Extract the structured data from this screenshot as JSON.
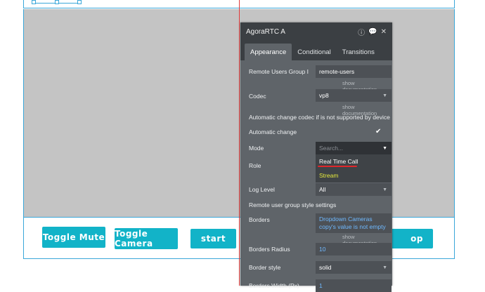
{
  "buttons": {
    "toggle_mute": "Toggle Mute",
    "toggle_camera": "Toggle Camera",
    "start": "start",
    "stop_partial": "op"
  },
  "panel": {
    "title": "AgoraRTC A",
    "tabs": [
      "Appearance",
      "Conditional",
      "Transitions"
    ],
    "remote_users_group_label": "Remote Users Group I",
    "remote_users_group_value": "remote-users",
    "show_documentation": "show documentation",
    "codec_label": "Codec",
    "codec_value": "vp8",
    "auto_change_note": "Automatic change codec if is not supported by device",
    "auto_change_label": "Automatic change",
    "mode_label": "Mode",
    "mode_search_placeholder": "Search...",
    "mode_options": [
      "Real Time Call",
      "Stream"
    ],
    "role_label": "Role",
    "log_level_label": "Log Level",
    "log_level_value": "All",
    "style_settings_note": "Remote user group style settings",
    "borders_label": "Borders",
    "borders_value": "Dropdown Cameras copy's value is not empty",
    "borders_radius_label": "Borders Radius",
    "borders_radius_value": "10",
    "border_style_label": "Border style",
    "border_style_value": "solid",
    "borders_width_label": "Borders Width (Px)",
    "borders_width_value": "1"
  }
}
